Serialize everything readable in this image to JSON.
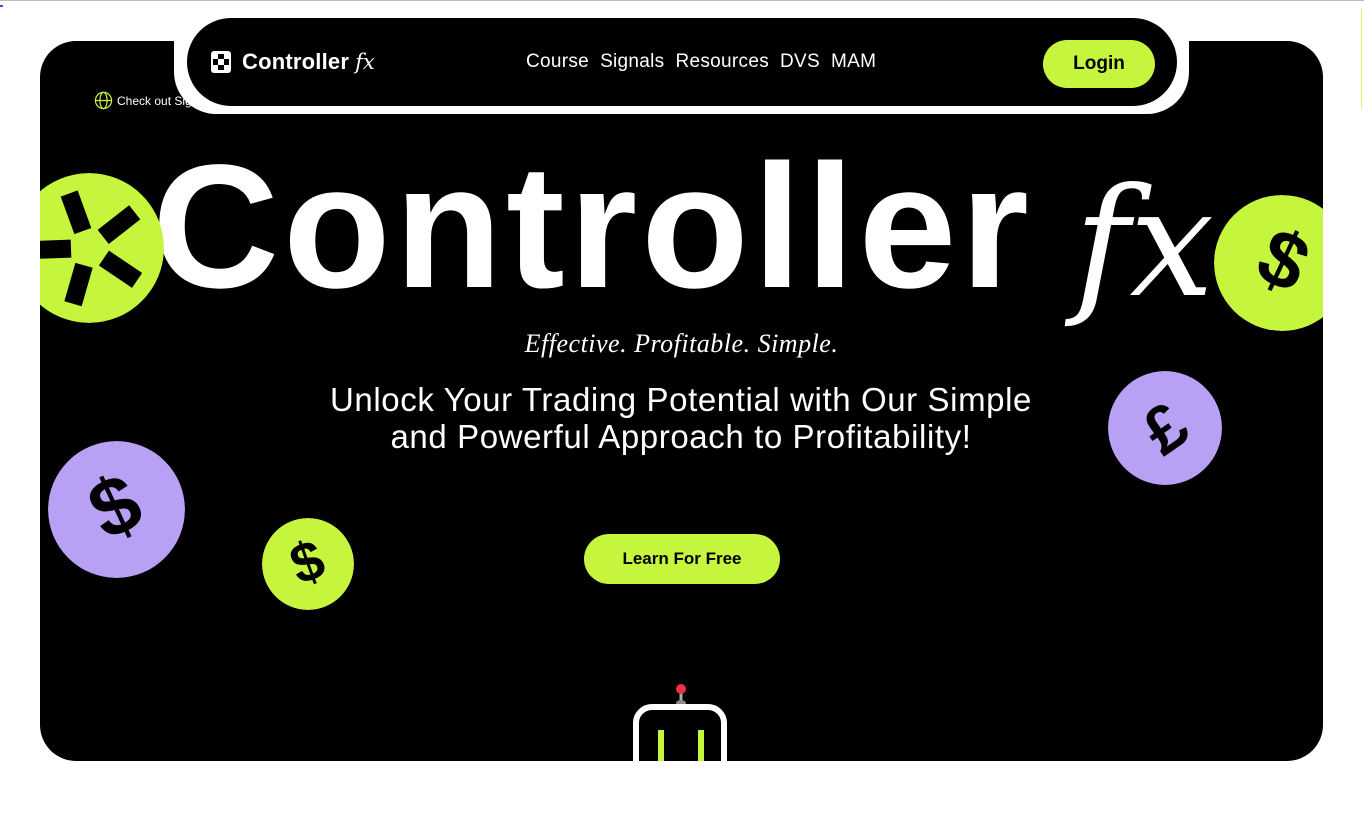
{
  "nav": {
    "brand": "Controller",
    "brand_suffix": "fx",
    "links": [
      "Course",
      "Signals",
      "Resources",
      "DVS",
      "MAM"
    ],
    "login_label": "Login"
  },
  "announcement": {
    "text": "Check out Sig"
  },
  "hero": {
    "wordmark": "Controller",
    "wordmark_suffix": "fx",
    "tagline": "Effective. Profitable. Simple.",
    "headline_line1": "Unlock Your Trading Potential with Our Simple",
    "headline_line2": "and Powerful Approach to Profitability!",
    "cta_label": "Learn For Free"
  },
  "colors": {
    "background": "#000000",
    "accent": "#c6f53e",
    "purple": "#b8a0f5",
    "text": "#ffffff"
  },
  "icons": [
    "globe-icon",
    "star-coin-icon",
    "dollar-coin-icon",
    "pound-coin-icon",
    "robot-icon"
  ]
}
